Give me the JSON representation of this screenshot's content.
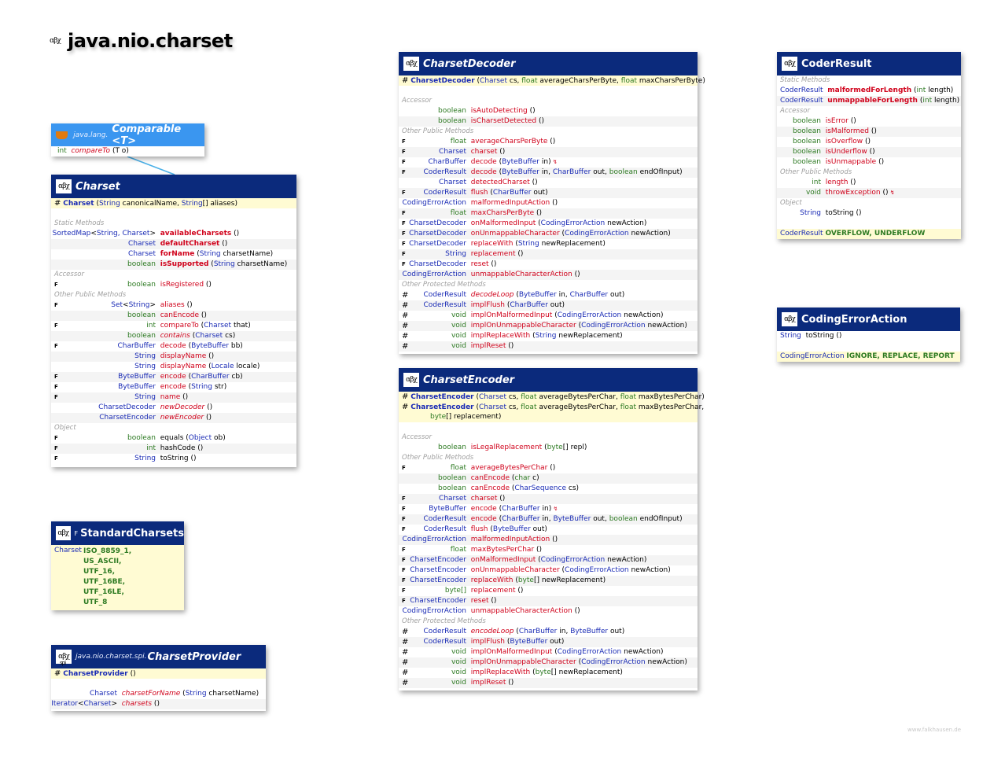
{
  "page": {
    "title": "java.nio.charset",
    "credit": "www.falkhausen.de"
  },
  "colors": {
    "header": "#0b2a7c",
    "interface_header": "#3a96f0",
    "method": "#d0021b",
    "type": "#1a2bb5",
    "primitive": "#2d7a22",
    "ctor_bg": "#fffbd3"
  },
  "comparable": {
    "package": "java.lang.",
    "name": "Comparable <T>",
    "method": {
      "ret": "int",
      "name": "compareTo",
      "params": "(T o)"
    }
  },
  "charset": {
    "name": "Charset",
    "ctor": {
      "name": "Charset",
      "p1t": "String",
      "p1": " canonicalName, ",
      "p2t": "String",
      "p2": "[] aliases)"
    },
    "sections": {
      "static": "Static Methods",
      "accessor": "Accessor",
      "other": "Other Public Methods",
      "object": "Object"
    },
    "static": [
      {
        "ret": "SortedMap<String, Charset>",
        "name": "availableCharsets",
        "params": " ()"
      },
      {
        "ret": "Charset",
        "name": "defaultCharset",
        "params": " ()"
      },
      {
        "ret": "Charset",
        "name": "forName",
        "params": " (String charsetName)"
      },
      {
        "ret": "boolean",
        "name": "isSupported",
        "params": " (String charsetName)"
      }
    ],
    "accessor": [
      {
        "mark": "F",
        "ret": "boolean",
        "name": "isRegistered",
        "params": " ()"
      }
    ],
    "other": [
      {
        "mark": "F",
        "ret": "Set<String>",
        "name": "aliases",
        "params": " ()"
      },
      {
        "mark": "",
        "ret": "boolean",
        "name": "canEncode",
        "params": " ()"
      },
      {
        "mark": "F",
        "ret": "int",
        "name": "compareTo",
        "params": " (Charset that)"
      },
      {
        "mark": "",
        "ret": "boolean",
        "name": "contains",
        "params": " (Charset cs)"
      },
      {
        "mark": "F",
        "ret": "CharBuffer",
        "name": "decode",
        "params": " (ByteBuffer bb)"
      },
      {
        "mark": "",
        "ret": "String",
        "name": "displayName",
        "params": " ()"
      },
      {
        "mark": "",
        "ret": "String",
        "name": "displayName",
        "params": " (Locale locale)"
      },
      {
        "mark": "F",
        "ret": "ByteBuffer",
        "name": "encode",
        "params": " (CharBuffer cb)"
      },
      {
        "mark": "F",
        "ret": "ByteBuffer",
        "name": "encode",
        "params": " (String str)"
      },
      {
        "mark": "F",
        "ret": "String",
        "name": "name",
        "params": " ()"
      },
      {
        "mark": "",
        "ret": "CharsetDecoder",
        "name": "newDecoder",
        "params": " ()"
      },
      {
        "mark": "",
        "ret": "CharsetEncoder",
        "name": "newEncoder",
        "params": " ()"
      }
    ],
    "object": [
      {
        "mark": "F",
        "ret": "boolean",
        "name": "equals",
        "params": " (Object ob)"
      },
      {
        "mark": "F",
        "ret": "int",
        "name": "hashCode",
        "params": " ()"
      },
      {
        "mark": "F",
        "ret": "String",
        "name": "toString",
        "params": " ()"
      }
    ]
  },
  "standard_charsets": {
    "final_mark": "F",
    "name": "StandardCharsets",
    "type": "Charset",
    "constants": [
      "ISO_8859_1,",
      "US_ASCII,",
      "UTF_16,",
      "UTF_16BE,",
      "UTF_16LE,",
      "UTF_8"
    ]
  },
  "charset_provider": {
    "spi": "spi",
    "package": "java.nio.charset.spi.",
    "name": "CharsetProvider",
    "ctor": "CharsetProvider",
    "ctor_params": " ()",
    "methods": [
      {
        "ret": "Charset",
        "name": "charsetForName",
        "params": " (String charsetName)"
      },
      {
        "ret": "Iterator<Charset>",
        "name": "charsets",
        "params": " ()"
      }
    ]
  },
  "decoder": {
    "name": "CharsetDecoder",
    "ctor": "CharsetDecoder",
    "ctor_params": " (Charset cs, float averageCharsPerByte, float maxCharsPerByte)",
    "sections": {
      "accessor": "Accessor",
      "other": "Other Public Methods",
      "protected": "Other Protected Methods"
    },
    "accessor": [
      {
        "mark": "",
        "ret": "boolean",
        "name": "isAutoDetecting",
        "params": " ()"
      },
      {
        "mark": "",
        "ret": "boolean",
        "name": "isCharsetDetected",
        "params": " ()"
      }
    ],
    "other": [
      {
        "mark": "F",
        "ret": "float",
        "name": "averageCharsPerByte",
        "params": " ()"
      },
      {
        "mark": "F",
        "ret": "Charset",
        "name": "charset",
        "params": " ()"
      },
      {
        "mark": "F",
        "ret": "CharBuffer",
        "name": "decode",
        "params": " (ByteBuffer in)",
        "throws": "↯"
      },
      {
        "mark": "F",
        "ret": "CoderResult",
        "name": "decode",
        "params": " (ByteBuffer in, CharBuffer out, boolean endOfInput)"
      },
      {
        "mark": "",
        "ret": "Charset",
        "name": "detectedCharset",
        "params": " ()"
      },
      {
        "mark": "F",
        "ret": "CoderResult",
        "name": "flush",
        "params": " (CharBuffer out)"
      },
      {
        "mark": "",
        "ret": "CodingErrorAction",
        "name": "malformedInputAction",
        "params": " ()"
      },
      {
        "mark": "F",
        "ret": "float",
        "name": "maxCharsPerByte",
        "params": " ()"
      },
      {
        "mark": "F",
        "ret": "CharsetDecoder",
        "name": "onMalformedInput",
        "params": " (CodingErrorAction newAction)"
      },
      {
        "mark": "F",
        "ret": "CharsetDecoder",
        "name": "onUnmappableCharacter",
        "params": " (CodingErrorAction newAction)"
      },
      {
        "mark": "F",
        "ret": "CharsetDecoder",
        "name": "replaceWith",
        "params": " (String newReplacement)"
      },
      {
        "mark": "F",
        "ret": "String",
        "name": "replacement",
        "params": " ()"
      },
      {
        "mark": "F",
        "ret": "CharsetDecoder",
        "name": "reset",
        "params": " ()"
      },
      {
        "mark": "",
        "ret": "CodingErrorAction",
        "name": "unmappableCharacterAction",
        "params": " ()"
      }
    ],
    "protected": [
      {
        "mark": "#",
        "ret": "CoderResult",
        "name": "decodeLoop",
        "params": " (ByteBuffer in, CharBuffer out)",
        "italic": true
      },
      {
        "mark": "#",
        "ret": "CoderResult",
        "name": "implFlush",
        "params": " (CharBuffer out)"
      },
      {
        "mark": "#",
        "ret": "void",
        "name": "implOnMalformedInput",
        "params": " (CodingErrorAction newAction)"
      },
      {
        "mark": "#",
        "ret": "void",
        "name": "implOnUnmappableCharacter",
        "params": " (CodingErrorAction newAction)"
      },
      {
        "mark": "#",
        "ret": "void",
        "name": "implReplaceWith",
        "params": " (String newReplacement)"
      },
      {
        "mark": "#",
        "ret": "void",
        "name": "implReset",
        "params": " ()"
      }
    ]
  },
  "encoder": {
    "name": "CharsetEncoder",
    "ctors": [
      {
        "name": "CharsetEncoder",
        "params": " (Charset cs, float averageBytesPerChar, float maxBytesPerChar)"
      },
      {
        "name": "CharsetEncoder",
        "params": " (Charset cs, float averageBytesPerChar, float maxBytesPerChar,",
        "cont": "byte[] replacement)"
      }
    ],
    "sections": {
      "accessor": "Accessor",
      "other": "Other Public Methods",
      "protected": "Other Protected Methods"
    },
    "accessor": [
      {
        "mark": "",
        "ret": "boolean",
        "name": "isLegalReplacement",
        "params": " (byte[] repl)"
      }
    ],
    "other": [
      {
        "mark": "F",
        "ret": "float",
        "name": "averageBytesPerChar",
        "params": " ()"
      },
      {
        "mark": "",
        "ret": "boolean",
        "name": "canEncode",
        "params": " (char c)"
      },
      {
        "mark": "",
        "ret": "boolean",
        "name": "canEncode",
        "params": " (CharSequence cs)"
      },
      {
        "mark": "F",
        "ret": "Charset",
        "name": "charset",
        "params": " ()"
      },
      {
        "mark": "F",
        "ret": "ByteBuffer",
        "name": "encode",
        "params": " (CharBuffer in)",
        "throws": "↯"
      },
      {
        "mark": "F",
        "ret": "CoderResult",
        "name": "encode",
        "params": " (CharBuffer in, ByteBuffer out, boolean endOfInput)"
      },
      {
        "mark": "F",
        "ret": "CoderResult",
        "name": "flush",
        "params": " (ByteBuffer out)"
      },
      {
        "mark": "",
        "ret": "CodingErrorAction",
        "name": "malformedInputAction",
        "params": " ()"
      },
      {
        "mark": "F",
        "ret": "float",
        "name": "maxBytesPerChar",
        "params": " ()"
      },
      {
        "mark": "F",
        "ret": "CharsetEncoder",
        "name": "onMalformedInput",
        "params": " (CodingErrorAction newAction)"
      },
      {
        "mark": "F",
        "ret": "CharsetEncoder",
        "name": "onUnmappableCharacter",
        "params": " (CodingErrorAction newAction)"
      },
      {
        "mark": "F",
        "ret": "CharsetEncoder",
        "name": "replaceWith",
        "params": " (byte[] newReplacement)"
      },
      {
        "mark": "F",
        "ret": "byte[]",
        "name": "replacement",
        "params": " ()"
      },
      {
        "mark": "F",
        "ret": "CharsetEncoder",
        "name": "reset",
        "params": " ()"
      },
      {
        "mark": "",
        "ret": "CodingErrorAction",
        "name": "unmappableCharacterAction",
        "params": " ()"
      }
    ],
    "protected": [
      {
        "mark": "#",
        "ret": "CoderResult",
        "name": "encodeLoop",
        "params": " (CharBuffer in, ByteBuffer out)",
        "italic": true
      },
      {
        "mark": "#",
        "ret": "CoderResult",
        "name": "implFlush",
        "params": " (ByteBuffer out)"
      },
      {
        "mark": "#",
        "ret": "void",
        "name": "implOnMalformedInput",
        "params": " (CodingErrorAction newAction)"
      },
      {
        "mark": "#",
        "ret": "void",
        "name": "implOnUnmappableCharacter",
        "params": " (CodingErrorAction newAction)"
      },
      {
        "mark": "#",
        "ret": "void",
        "name": "implReplaceWith",
        "params": " (byte[] newReplacement)"
      },
      {
        "mark": "#",
        "ret": "void",
        "name": "implReset",
        "params": " ()"
      }
    ]
  },
  "coder_result": {
    "name": "CoderResult",
    "sections": {
      "static": "Static Methods",
      "accessor": "Accessor",
      "other": "Other Public Methods",
      "object": "Object"
    },
    "static": [
      {
        "ret": "CoderResult",
        "name": "malformedForLength",
        "params": " (int length)"
      },
      {
        "ret": "CoderResult",
        "name": "unmappableForLength",
        "params": " (int length)"
      }
    ],
    "accessor": [
      {
        "ret": "boolean",
        "name": "isError",
        "params": " ()"
      },
      {
        "ret": "boolean",
        "name": "isMalformed",
        "params": " ()"
      },
      {
        "ret": "boolean",
        "name": "isOverflow",
        "params": " ()"
      },
      {
        "ret": "boolean",
        "name": "isUnderflow",
        "params": " ()"
      },
      {
        "ret": "boolean",
        "name": "isUnmappable",
        "params": " ()"
      }
    ],
    "other": [
      {
        "ret": "int",
        "name": "length",
        "params": " ()"
      },
      {
        "ret": "void",
        "name": "throwException",
        "params": " ()",
        "throws": "↯"
      }
    ],
    "object": [
      {
        "ret": "String",
        "name": "toString",
        "params": " ()"
      }
    ],
    "constants_type": "CoderResult",
    "constants": "OVERFLOW, UNDERFLOW"
  },
  "coding_error_action": {
    "name": "CodingErrorAction",
    "method": {
      "ret": "String",
      "name": "toString",
      "params": " ()"
    },
    "constants_type": "CodingErrorAction",
    "constants": "IGNORE, REPLACE, REPORT"
  }
}
